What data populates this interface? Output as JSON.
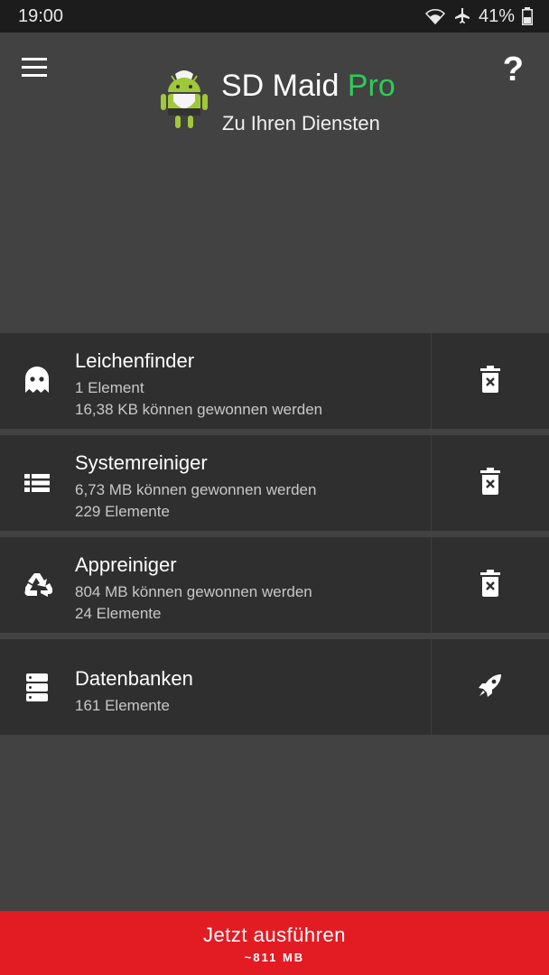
{
  "status_bar": {
    "time": "19:00",
    "battery": "41%",
    "icons": [
      "wifi-icon",
      "airplane-icon",
      "battery-icon"
    ]
  },
  "header": {
    "app_name": "SD Maid",
    "edition": "Pro",
    "tagline": "Zu Ihren Diensten",
    "menu_icon": "hamburger-menu-icon",
    "help_label": "?",
    "colors": {
      "edition": "#2ecc58",
      "background": "#424242"
    }
  },
  "tools": [
    {
      "title": "Leichenfinder",
      "line1": "1 Element",
      "line2": "16,38 KB können gewonnen werden",
      "icon": "ghost-icon",
      "action_icon": "delete-icon"
    },
    {
      "title": "Systemreiniger",
      "line1": "6,73 MB können gewonnen werden",
      "line2": "229 Elemente",
      "icon": "list-icon",
      "action_icon": "delete-icon"
    },
    {
      "title": "Appreiniger",
      "line1": "804 MB können gewonnen werden",
      "line2": "24 Elemente",
      "icon": "recycle-icon",
      "action_icon": "delete-icon"
    },
    {
      "title": "Datenbanken",
      "line1": "161 Elemente",
      "icon": "database-icon",
      "action_icon": "rocket-icon"
    }
  ],
  "run_button": {
    "label": "Jetzt ausführen",
    "size": "~811 MB",
    "color": "#e31b23"
  }
}
